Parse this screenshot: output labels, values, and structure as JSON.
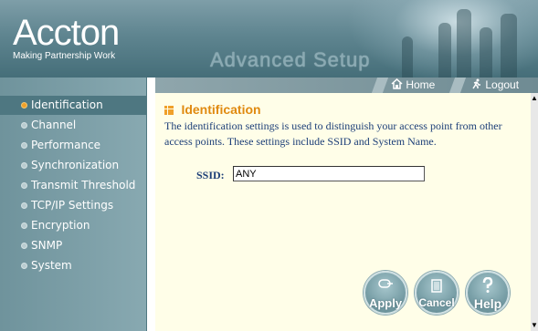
{
  "header": {
    "brand": "Accton",
    "tagline": "Making Partnership Work",
    "section_title": "Advanced Setup"
  },
  "toolbar": {
    "home_label": "Home",
    "logout_label": "Logout",
    "home_icon": "home-icon",
    "logout_icon": "running-person-icon"
  },
  "sidebar": {
    "items": [
      {
        "label": "Identification",
        "active": true
      },
      {
        "label": "Channel"
      },
      {
        "label": "Performance"
      },
      {
        "label": "Synchronization"
      },
      {
        "label": "Transmit Threshold"
      },
      {
        "label": "TCP/IP Settings"
      },
      {
        "label": "Encryption"
      },
      {
        "label": "SNMP"
      },
      {
        "label": "System"
      }
    ]
  },
  "main": {
    "title": "Identification",
    "description": "The identification settings is used to distinguish your access point from other access points. These settings include SSID and System Name.",
    "ssid_label": "SSID:",
    "ssid_value": "ANY"
  },
  "buttons": {
    "apply": "Apply",
    "cancel": "Cancel",
    "help": "Help"
  },
  "colors": {
    "accent": "#e08a10",
    "text_blue": "#1d3f78",
    "sidebar_bg": "#7d9fa7",
    "content_bg": "#fffee8"
  }
}
